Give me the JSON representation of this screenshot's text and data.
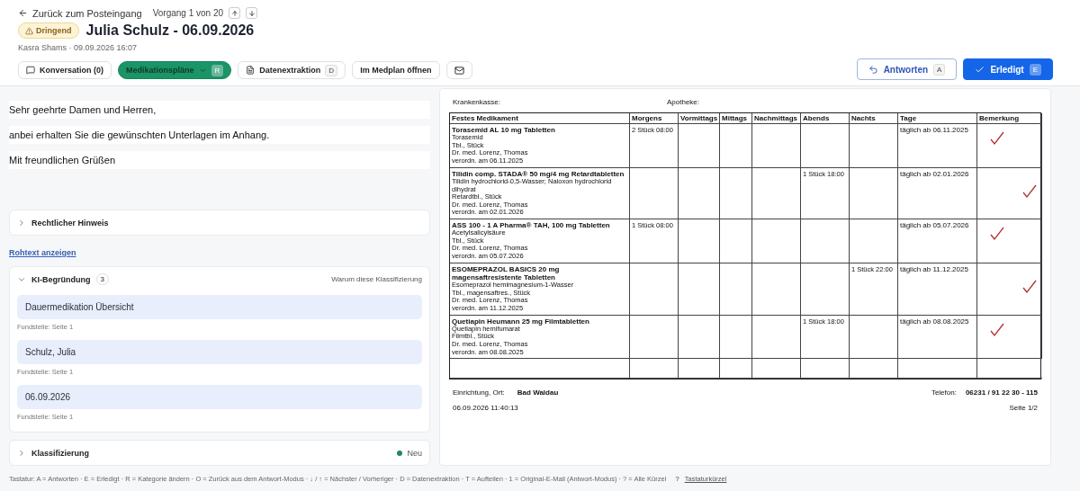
{
  "header": {
    "back_link": "Zurück zum Posteingang",
    "counter": "Vorgang 1 von 20",
    "badge": "Dringend",
    "title": "Julia Schulz - 06.09.2026",
    "meta": "Kasra Shams · 09.09.2026 16:07",
    "tabs": [
      {
        "kind": "chat",
        "label": "Konversation (0)",
        "selected": false
      },
      {
        "kind": "dropdown",
        "label": "Medikationspläne",
        "shortcut": "R",
        "selected": true
      },
      {
        "kind": "document",
        "label": "Datenextraktion",
        "shortcut": "D",
        "selected": false
      },
      {
        "kind": "plain",
        "label": "Im Medplan öffnen",
        "selected": false
      },
      {
        "kind": "mail",
        "selected": false
      }
    ],
    "reply": {
      "label": "Antworten",
      "shortcut": "A"
    },
    "done": {
      "label": "Erledigt",
      "shortcut": "E"
    }
  },
  "email": {
    "lines": [
      "Sehr geehrte Damen und Herren,",
      "anbei erhalten Sie die gewünschten Unterlagen im Anhang.",
      "Mit freundlichen Grüßen"
    ]
  },
  "legal": {
    "title": "Rechtlicher Hinweis",
    "expanded": false
  },
  "raw_link": "Rohtext anzeigen",
  "ki": {
    "title": "KI-Begründung",
    "count": "3",
    "expanded": true,
    "hint": "Warum diese Klassifizierung",
    "items": [
      {
        "value": "Dauermedikation Übersicht",
        "source": "Fundstelle: Seite 1"
      },
      {
        "value": "Schulz, Julia",
        "source": "Fundstelle: Seite 1"
      },
      {
        "value": "06.09.2026",
        "source": "Fundstelle: Seite 1"
      }
    ]
  },
  "classification": {
    "title": "Klassifizierung",
    "expanded": false,
    "status": "Neu",
    "color": "#1f8a5c"
  },
  "document": {
    "krankenkasse": "Krankenkasse:",
    "apotheke": "Apotheke:",
    "columns": [
      "Festes Medikament",
      "Morgens",
      "Vormittags",
      "Mittags",
      "Nachmittags",
      "Abends",
      "Nachts",
      "Tage",
      "Bemerkung"
    ],
    "rows": [
      {
        "name": "Torasemid AL 10 mg Tabletten",
        "details": [
          "Torasemid",
          "Tbl., Stück",
          "Dr. med. Lorenz, Thomas",
          "verordn. am 06.11.2025"
        ],
        "kind": "morning",
        "dose": "2 Stück  08:00",
        "days": "täglich ab 06.11.2025",
        "checked": true
      },
      {
        "name": "Tilidin comp. STADA® 50 mg/4 mg Retardtabletten",
        "details": [
          "Tilidin hydrochlorid-0,5-Wasser; Naloxon hydrochlorid dihydrat",
          "Retardtbl., Stück",
          "Dr. med. Lorenz, Thomas",
          "verordn. am 02.01.2026"
        ],
        "kind": "evening",
        "dose": "1 Stück  18:00",
        "days": "täglich ab 02.01.2026",
        "checked": true
      },
      {
        "name": "ASS 100 - 1 A Pharma® TAH, 100 mg Tabletten",
        "details": [
          "Acetylsalicylsäure",
          "Tbl., Stück",
          "Dr. med. Lorenz, Thomas",
          "verordn. am 05.07.2026"
        ],
        "kind": "morning",
        "dose": "1 Stück  08:00",
        "days": "täglich ab 05.07.2026",
        "checked": true
      },
      {
        "name": "ESOMEPRAZOL BASICS 20 mg magensaftresistente Tabletten",
        "details": [
          "Esomeprazol hemimagnesium-1-Wasser",
          "Tbl., magensaftres., Stück",
          "Dr. med. Lorenz, Thomas",
          "verordn. am 11.12.2025"
        ],
        "kind": "night",
        "dose": "1 Stück  22:00",
        "days": "täglich ab 11.12.2025",
        "checked": true
      },
      {
        "name": "Quetiapin Heumann 25 mg Filmtabletten",
        "details": [
          "Quetiapin hemifumarat",
          "Filmtbl., Stück",
          "Dr. med. Lorenz, Thomas",
          "verordn. am 08.08.2025"
        ],
        "kind": "evening",
        "dose": "1 Stück  18:00",
        "days": "täglich ab 08.08.2025",
        "checked": true
      }
    ],
    "place_label": "Einrichtung, Ort:",
    "place": "Bad Waldau",
    "printed": "06.09.2026 11:40:13",
    "phone_label": "Telefon:",
    "phone": "06231 / 91 22 30 - 115",
    "page": "Seite 1/2"
  },
  "footer": {
    "shortcuts": "Tastatur: A = Antworten · E = Erledigt · R = Kategorie ändern · O = Zurück aus dem Antwort-Modus · ↓ / ↑ = Nächster / Vorheriger · D = Datenextraktion · T = Aufteilen · 1 = Original-E-Mail (Antwort-Modus) · ? = Alle Kürzel",
    "help": "?",
    "link": "Tastaturkürzel"
  }
}
